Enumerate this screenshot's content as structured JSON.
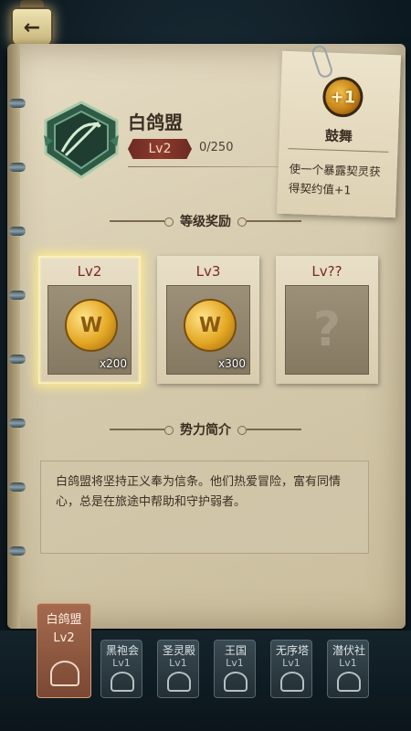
{
  "topbar": {
    "back_icon": "back-arrow-icon"
  },
  "faction": {
    "name": "白鸽盟",
    "level": "Lv2",
    "exp": "0/250",
    "emblem_icon": "crossbow-shield-emblem-icon"
  },
  "buff": {
    "icon": "buff-plus-one-icon",
    "icon_text": "+1",
    "name": "鼓舞",
    "desc": "使一个暴露契灵获得契约值+1"
  },
  "rewards": {
    "header": "等级奖励",
    "cards": [
      {
        "level": "Lv2",
        "icon": "gold-coin-icon",
        "coin_text": "W",
        "qty": "x200",
        "active": true
      },
      {
        "level": "Lv3",
        "icon": "gold-coin-icon",
        "coin_text": "W",
        "qty": "x300",
        "active": false
      },
      {
        "level": "Lv??",
        "icon": "question-mark-icon",
        "mystery": "?",
        "active": false
      }
    ]
  },
  "intro": {
    "header": "势力简介",
    "text": "白鸽盟将坚持正义奉为信条。他们热爱冒险，富有同情心，总是在旅途中帮助和守护弱者。"
  },
  "tabs": [
    {
      "name": "白鸽盟",
      "level": "Lv2",
      "active": true
    },
    {
      "name": "黑袍会",
      "level": "Lv1",
      "active": false
    },
    {
      "name": "圣灵殿",
      "level": "Lv1",
      "active": false
    },
    {
      "name": "王国",
      "level": "Lv1",
      "active": false
    },
    {
      "name": "无序塔",
      "level": "Lv1",
      "active": false
    },
    {
      "name": "潜伏社",
      "level": "Lv1",
      "active": false
    }
  ],
  "colors": {
    "accent_red": "#7a2a22",
    "active_tab": "#a56a4e",
    "background": "#0f1c24"
  }
}
